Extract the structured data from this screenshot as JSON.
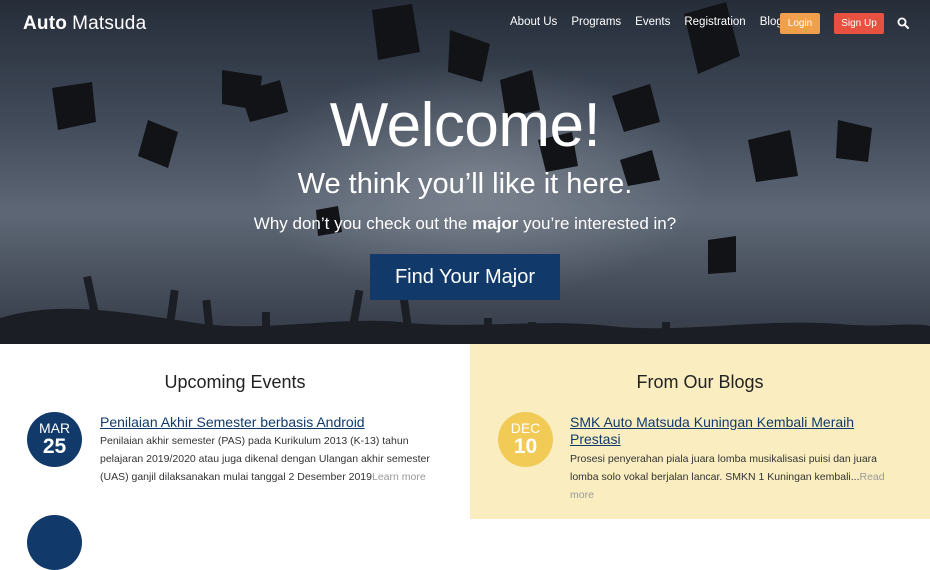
{
  "brand": {
    "part1": "Auto",
    "part2": "Matsuda"
  },
  "nav": {
    "links": [
      "About Us",
      "Programs",
      "Events",
      "Registration",
      "Blog"
    ],
    "login": "Login",
    "signup": "Sign Up",
    "search_icon": "search-icon"
  },
  "hero": {
    "welcome": "Welcome!",
    "tagline": "We think you’ll like it here.",
    "sub_before": "Why don’t you check out the ",
    "sub_bold": "major",
    "sub_after": " you’re interested in?",
    "cta": "Find Your Major"
  },
  "events": {
    "title": "Upcoming Events",
    "items": [
      {
        "month": "MAR",
        "day": "25",
        "title": "Penilaian Akhir Semester berbasis Android",
        "body": "Penilaian akhir semester (PAS) pada Kurikulum 2013 (K-13) tahun pelajaran 2019/2020 atau juga dikenal dengan Ulangan akhir semester (UAS) ganjil dilaksanakan mulai tanggal 2 Desember 2019",
        "more": "Learn more"
      }
    ]
  },
  "blogs": {
    "title": "From Our Blogs",
    "items": [
      {
        "month": "DEC",
        "day": "10",
        "title": "SMK Auto Matsuda Kuningan Kembali Meraih Prestasi",
        "body": "Prosesi penyerahan piala juara lomba musikalisasi puisi dan juara lomba solo vokal berjalan lancar. SMKN 1 Kuningan kembali...",
        "more": "Read more"
      }
    ]
  },
  "colors": {
    "navy": "#113a6b",
    "login": "#f0a04b",
    "signup": "#e8503f",
    "blog_bg": "#faeec0",
    "blog_badge": "#f1cb55"
  }
}
